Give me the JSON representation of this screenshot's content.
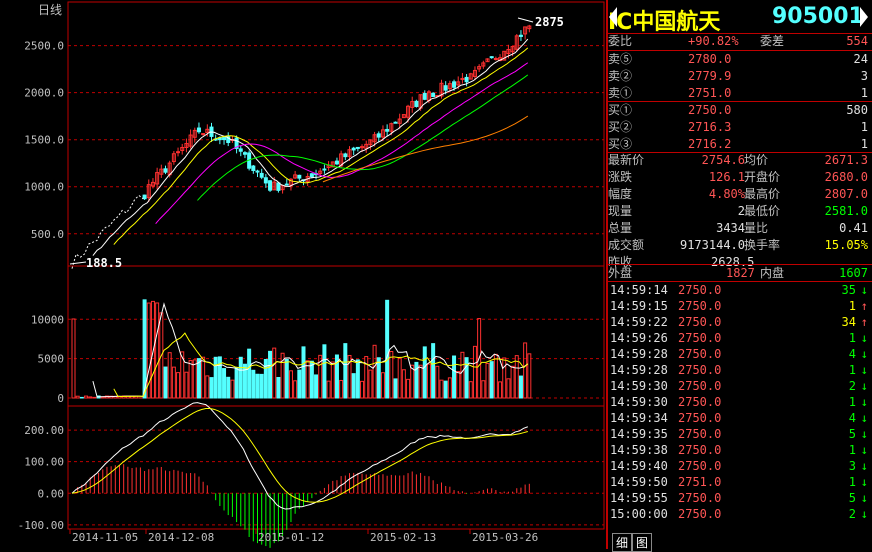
{
  "header": {
    "name": "IC中国航天",
    "code": "905001"
  },
  "chart_labels": {
    "period": "日线",
    "high_label": "2875",
    "low_label": "188.5"
  },
  "chart_data": [
    {
      "type": "candlestick",
      "panel": "price",
      "y_ticks": [
        "500.0",
        "1000.0",
        "1500.0",
        "2000.0",
        "2500.0"
      ],
      "ylim": [
        200,
        2900
      ],
      "ma_colors": [
        "#ffffff",
        "#ffff00",
        "#ff00ff",
        "#00ff00",
        "#ff8000"
      ],
      "up_color": "#ff3030",
      "down_color": "#54ffff"
    },
    {
      "type": "bar",
      "panel": "volume",
      "y_ticks": [
        "0",
        "5000",
        "10000"
      ],
      "ylim": [
        0,
        16000
      ]
    },
    {
      "type": "macd",
      "panel": "indicator",
      "y_ticks": [
        "-100.00",
        "0.00",
        "100.00",
        "200.00"
      ],
      "ylim": [
        -110,
        270
      ]
    }
  ],
  "x_ticks": [
    "2014-11-05",
    "2014-12-08",
    "2015-01-12",
    "2015-02-13",
    "2015-03-26"
  ],
  "quote": {
    "weibi_label": "委比",
    "weibi": "+90.82%",
    "weicha_label": "委差",
    "weicha": "554",
    "asks": [
      {
        "label": "卖⑤",
        "price": "2780.0",
        "vol": "24"
      },
      {
        "label": "卖②",
        "price": "2779.9",
        "vol": "3"
      },
      {
        "label": "卖①",
        "price": "2751.0",
        "vol": "1"
      }
    ],
    "bids": [
      {
        "label": "买①",
        "price": "2750.0",
        "vol": "580"
      },
      {
        "label": "买②",
        "price": "2716.3",
        "vol": "1"
      },
      {
        "label": "买③",
        "price": "2716.2",
        "vol": "1"
      }
    ],
    "stats": [
      {
        "l1": "最新价",
        "v1": "2754.6",
        "l2": "均价",
        "v2": "2671.3",
        "c1": "red",
        "c2": "red"
      },
      {
        "l1": "涨跌",
        "v1": "126.1",
        "l2": "开盘价",
        "v2": "2680.0",
        "c1": "red",
        "c2": "red"
      },
      {
        "l1": "幅度",
        "v1": "4.80%",
        "l2": "最高价",
        "v2": "2807.0",
        "c1": "red",
        "c2": "red"
      },
      {
        "l1": "现量",
        "v1": "2",
        "l2": "最低价",
        "v2": "2581.0",
        "c1": "white",
        "c2": "green"
      },
      {
        "l1": "总量",
        "v1": "3434",
        "l2": "量比",
        "v2": "0.41",
        "c1": "white",
        "c2": "white"
      },
      {
        "l1": "成交额",
        "v1": "9173144.0",
        "l2": "换手率",
        "v2": "15.05%",
        "c1": "white",
        "c2": "yel"
      }
    ],
    "prev_close_label": "昨收",
    "prev_close": "2628.5",
    "outer_label": "外盘",
    "outer": "1827",
    "inner_label": "内盘",
    "inner": "1607"
  },
  "ticks": [
    {
      "t": "14:59:14",
      "p": "2750.0",
      "v": "35",
      "d": "down"
    },
    {
      "t": "14:59:15",
      "p": "2750.0",
      "v": "1",
      "d": "up"
    },
    {
      "t": "14:59:22",
      "p": "2750.0",
      "v": "34",
      "d": "up"
    },
    {
      "t": "14:59:26",
      "p": "2750.0",
      "v": "1",
      "d": "down"
    },
    {
      "t": "14:59:28",
      "p": "2750.0",
      "v": "4",
      "d": "down"
    },
    {
      "t": "14:59:28",
      "p": "2750.0",
      "v": "1",
      "d": "down"
    },
    {
      "t": "14:59:30",
      "p": "2750.0",
      "v": "2",
      "d": "down"
    },
    {
      "t": "14:59:30",
      "p": "2750.0",
      "v": "1",
      "d": "down"
    },
    {
      "t": "14:59:34",
      "p": "2750.0",
      "v": "4",
      "d": "down"
    },
    {
      "t": "14:59:35",
      "p": "2750.0",
      "v": "5",
      "d": "down"
    },
    {
      "t": "14:59:38",
      "p": "2750.0",
      "v": "1",
      "d": "down"
    },
    {
      "t": "14:59:40",
      "p": "2750.0",
      "v": "3",
      "d": "down"
    },
    {
      "t": "14:59:50",
      "p": "2751.0",
      "v": "1",
      "d": "down"
    },
    {
      "t": "14:59:55",
      "p": "2750.0",
      "v": "5",
      "d": "down"
    },
    {
      "t": "15:00:00",
      "p": "2750.0",
      "v": "2",
      "d": "down"
    }
  ],
  "tabs": [
    "细",
    "图"
  ]
}
